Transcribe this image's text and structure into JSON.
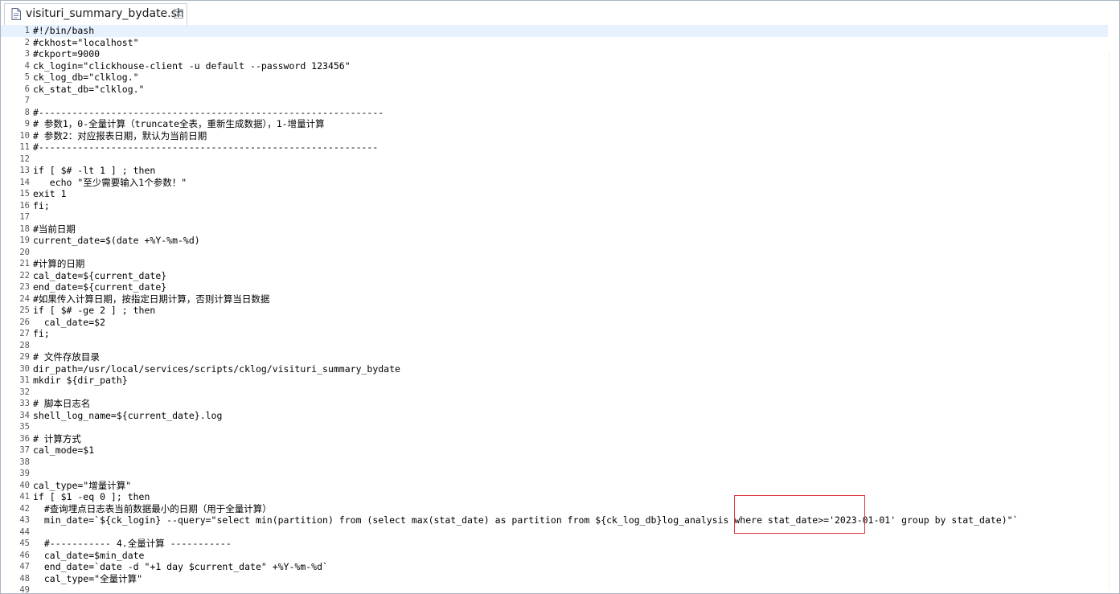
{
  "tab": {
    "title": "visituri_summary_bydate.sh",
    "file_icon": "shell-file-icon",
    "close_icon": "close-icon"
  },
  "colors": {
    "current_line": "#e8f2fe",
    "highlight_box": "#e0363b",
    "line_number": "#555555"
  },
  "editor": {
    "current_line": 1,
    "lines": [
      {
        "n": "1",
        "t": "#!/bin/bash"
      },
      {
        "n": "2",
        "t": "#ckhost=\"localhost\""
      },
      {
        "n": "3",
        "t": "#ckport=9000"
      },
      {
        "n": "4",
        "t": "ck_login=\"clickhouse-client -u default --password 123456\""
      },
      {
        "n": "5",
        "t": "ck_log_db=\"clklog.\""
      },
      {
        "n": "6",
        "t": "ck_stat_db=\"clklog.\""
      },
      {
        "n": "7",
        "t": ""
      },
      {
        "n": "8",
        "t": "#--------------------------------------------------------------"
      },
      {
        "n": "9",
        "t": "# 参数1，0-全量计算（truncate全表，重新生成数据），1-增量计算"
      },
      {
        "n": "10",
        "t": "# 参数2：对应报表日期，默认为当前日期"
      },
      {
        "n": "11",
        "t": "#-------------------------------------------------------------"
      },
      {
        "n": "12",
        "t": ""
      },
      {
        "n": "13",
        "t": "if [ $# -lt 1 ] ; then"
      },
      {
        "n": "14",
        "t": "   echo \"至少需要输入1个参数！\""
      },
      {
        "n": "15",
        "t": "exit 1"
      },
      {
        "n": "16",
        "t": "fi;"
      },
      {
        "n": "17",
        "t": ""
      },
      {
        "n": "18",
        "t": "#当前日期"
      },
      {
        "n": "19",
        "t": "current_date=$(date +%Y-%m-%d)"
      },
      {
        "n": "20",
        "t": ""
      },
      {
        "n": "21",
        "t": "#计算的日期"
      },
      {
        "n": "22",
        "t": "cal_date=${current_date}"
      },
      {
        "n": "23",
        "t": "end_date=${current_date}"
      },
      {
        "n": "24",
        "t": "#如果传入计算日期，按指定日期计算，否则计算当日数据"
      },
      {
        "n": "25",
        "t": "if [ $# -ge 2 ] ; then"
      },
      {
        "n": "26",
        "t": "  cal_date=$2"
      },
      {
        "n": "27",
        "t": "fi;"
      },
      {
        "n": "28",
        "t": ""
      },
      {
        "n": "29",
        "t": "# 文件存放目录"
      },
      {
        "n": "30",
        "t": "dir_path=/usr/local/services/scripts/cklog/visituri_summary_bydate"
      },
      {
        "n": "31",
        "t": "mkdir ${dir_path}"
      },
      {
        "n": "32",
        "t": ""
      },
      {
        "n": "33",
        "t": "# 脚本日志名"
      },
      {
        "n": "34",
        "t": "shell_log_name=${current_date}.log"
      },
      {
        "n": "35",
        "t": ""
      },
      {
        "n": "36",
        "t": "# 计算方式"
      },
      {
        "n": "37",
        "t": "cal_mode=$1"
      },
      {
        "n": "38",
        "t": ""
      },
      {
        "n": "39",
        "t": ""
      },
      {
        "n": "40",
        "t": "cal_type=\"增量计算\""
      },
      {
        "n": "41",
        "t": "if [ $1 -eq 0 ]; then"
      },
      {
        "n": "42",
        "t": "  #查询埋点日志表当前数据最小的日期（用于全量计算）"
      },
      {
        "n": "43",
        "t": "  min_date=`${ck_login} --query=\"select min(partition) from (select max(stat_date) as partition from ${ck_log_db}log_analysis where stat_date>='2023-01-01' group by stat_date)\"`"
      },
      {
        "n": "44",
        "t": ""
      },
      {
        "n": "45",
        "t": "  #----------- 4.全量计算 -----------"
      },
      {
        "n": "46",
        "t": "  cal_date=$min_date"
      },
      {
        "n": "47",
        "t": "  end_date=`date -d \"+1 day $current_date\" +%Y-%m-%d`"
      },
      {
        "n": "48",
        "t": "  cal_type=\"全量计算\""
      },
      {
        "n": "49",
        "t": ""
      }
    ]
  }
}
